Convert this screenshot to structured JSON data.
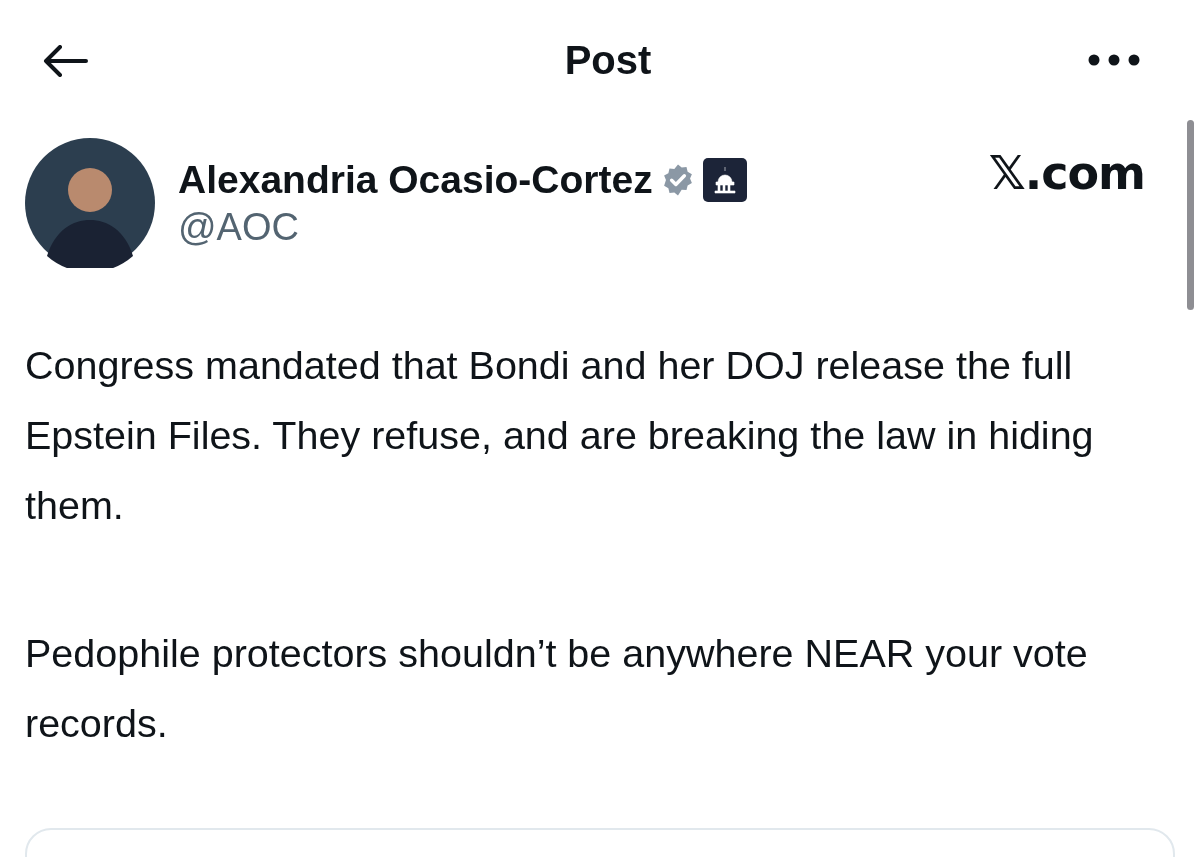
{
  "header": {
    "title": "Post"
  },
  "author": {
    "name": "Alexandria Ocasio-Cortez",
    "verified": true,
    "handle": "@AOC"
  },
  "source": "𝕏.com",
  "body": {
    "paragraphs": [
      "Congress mandated that Bondi and her DOJ release the full Epstein Files. They refuse, and are breaking the law in hiding them.",
      "Pedophile protectors shouldn’t be anywhere NEAR your vote records."
    ]
  }
}
